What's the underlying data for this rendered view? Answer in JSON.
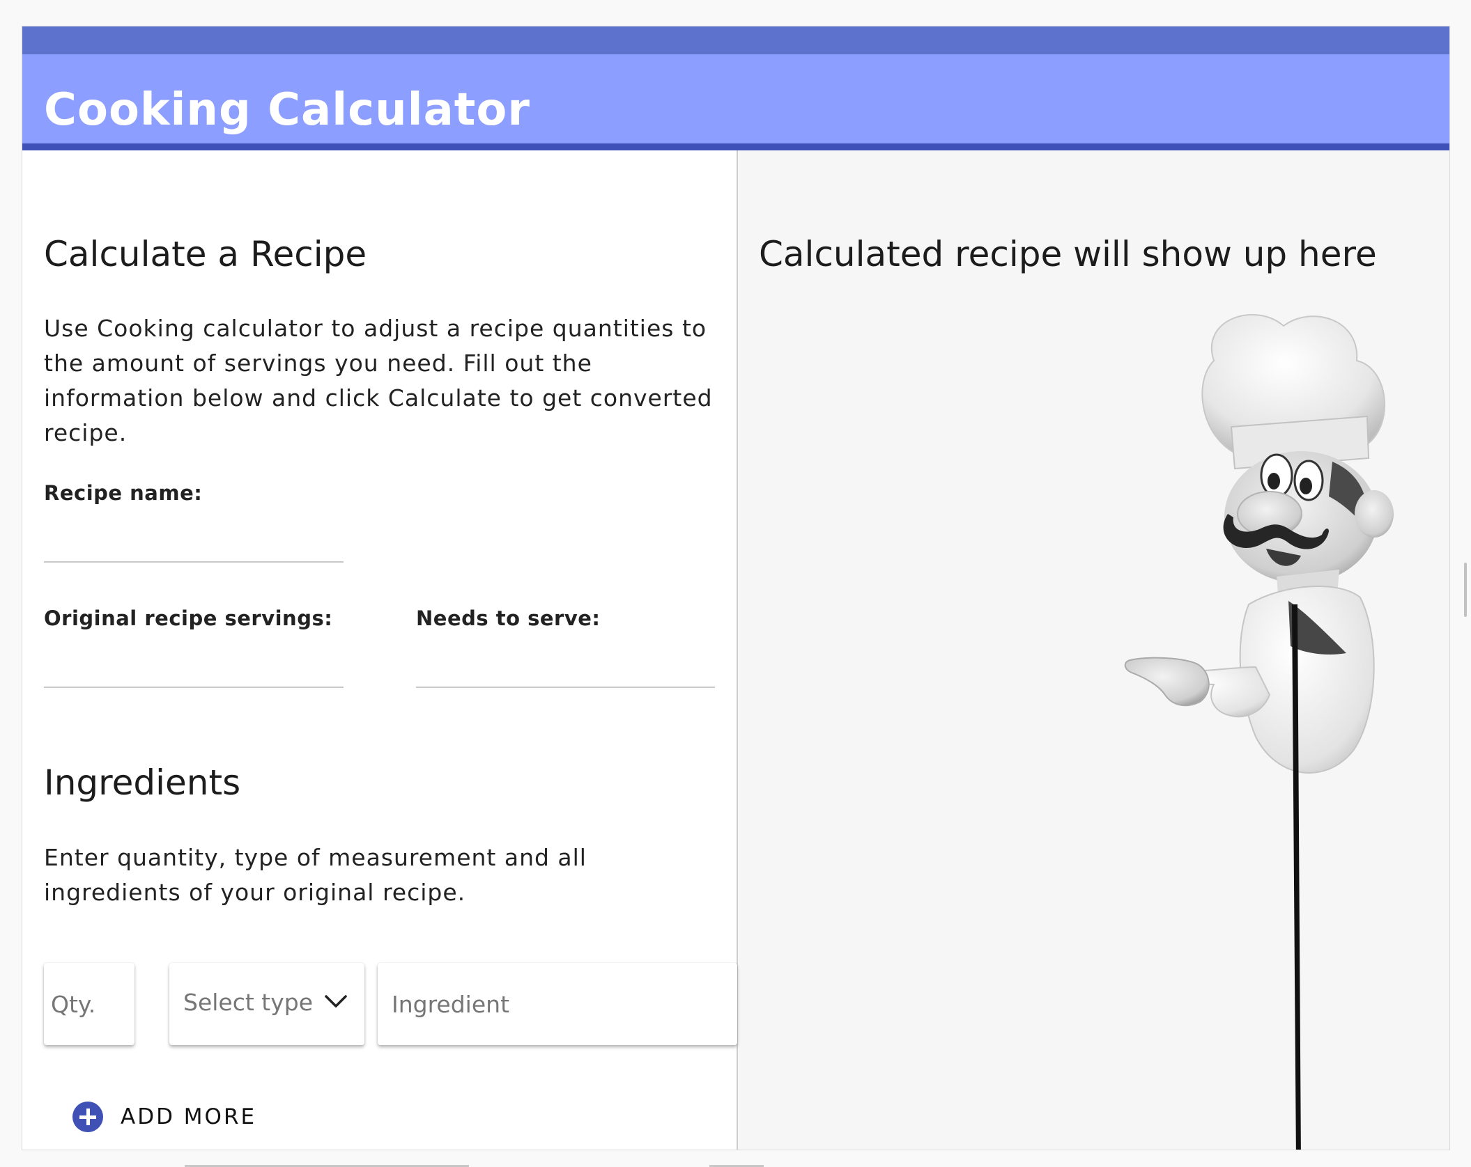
{
  "app": {
    "title": "Cooking Calculator"
  },
  "form": {
    "heading": "Calculate a Recipe",
    "description": "Use Cooking calculator to adjust a recipe quantities to the amount of servings you need. Fill out the information below and click Calculate to get converted recipe.",
    "recipe_name_label": "Recipe name:",
    "recipe_name_value": "",
    "original_servings_label": "Original recipe servings:",
    "original_servings_value": "",
    "needs_to_serve_label": "Needs to serve:",
    "needs_to_serve_value": ""
  },
  "ingredients": {
    "heading": "Ingredients",
    "description": "Enter quantity, type of measurement and all ingredients of your original recipe.",
    "qty_placeholder": "Qty.",
    "type_select_label": "Select type",
    "ingredient_placeholder": "Ingredient",
    "add_more_label": "ADD MORE"
  },
  "result": {
    "heading": "Calculated recipe will show up here"
  },
  "colors": {
    "header_bg": "#8c9eff",
    "header_top": "#5c72cc",
    "header_bottom": "#3d51b8",
    "accent": "#3f51b5",
    "result_bg": "#f6f6f6"
  },
  "icons": {
    "add_more": "plus-circle-icon",
    "select": "chevron-down-icon",
    "mascot": "chef-mascot-illustration"
  }
}
